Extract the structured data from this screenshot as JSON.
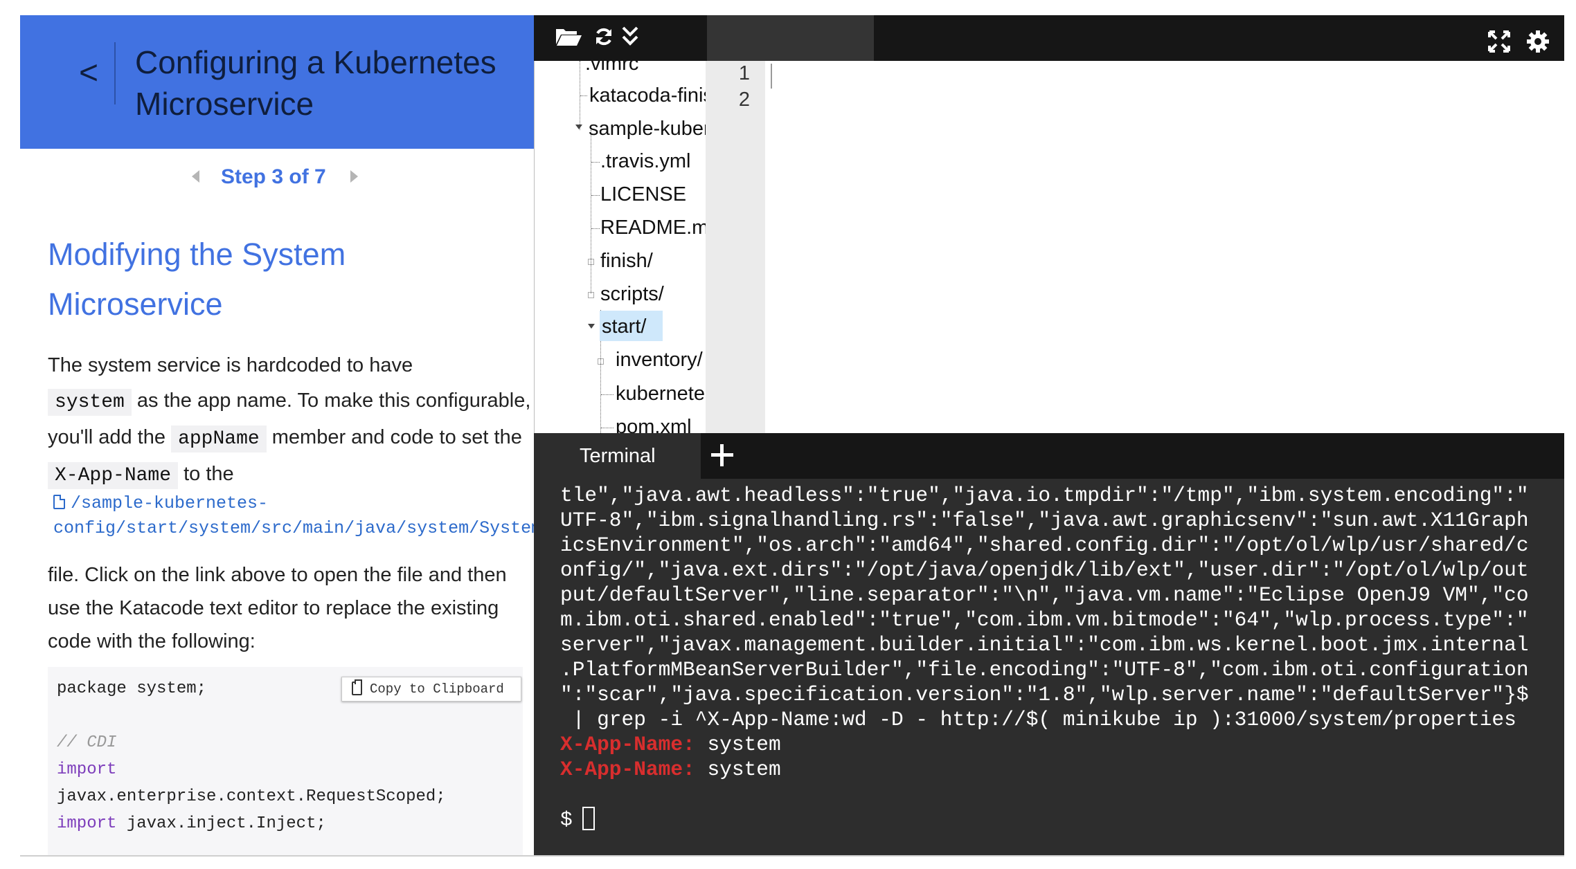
{
  "tutorial": {
    "back_label": "<",
    "title": "Configuring a Kubernetes Microservice",
    "step_label": "Step 3 of 7",
    "section_heading": "Modifying the System Microservice",
    "intro": {
      "p1": "The system service is hardcoded to have",
      "code_system": "system",
      "p2": "as the app name. To make this configurable, you'll add the",
      "code_appname": "appName",
      "p3": "member and code to set the",
      "code_header": "X-App-Name",
      "p4": "to the"
    },
    "file_link": "/sample-kubernetes-config/start/system/src/main/java/system/SystemResource.java",
    "outro": "file. Click on the link above to open the file and then use the Katacode text editor to replace the existing code with the following:",
    "copy_button_label": "Copy to Clipboard",
    "code_lines": {
      "l1": "package system;",
      "l2": "// CDI",
      "l3": "import",
      "l4": "javax.enterprise.context.RequestScoped;",
      "l5_kw": "import",
      "l5_rest": "javax.inject.Inject;"
    }
  },
  "toolbar": {
    "icons": [
      "folder-open-icon",
      "refresh-icon",
      "collapse-all-icon",
      "fullscreen-icon",
      "settings-icon"
    ]
  },
  "file_tree": {
    "items": {
      "vimrc": ".vimrc",
      "katacoda": "katacoda-finish.sh",
      "sample": "sample-kubernetes-config",
      "travis": ".travis.yml",
      "license": "LICENSE",
      "readme": "README.md",
      "finish": "finish/",
      "scripts": "scripts/",
      "start": "start/",
      "inventory": "inventory/",
      "kubernetes": "kubernetes.yaml",
      "pom": "pom.xml"
    },
    "selected": "start/"
  },
  "editor": {
    "line_numbers": [
      "1",
      "2"
    ]
  },
  "terminal": {
    "tab_label": "Terminal",
    "lines": [
      "tle\",\"java.awt.headless\":\"true\",\"java.io.tmpdir\":\"/tmp\",\"ibm.system.encoding\":\"",
      "UTF-8\",\"ibm.signalhandling.rs\":\"false\",\"java.awt.graphicsenv\":\"sun.awt.X11Graph",
      "icsEnvironment\",\"os.arch\":\"amd64\",\"shared.config.dir\":\"/opt/ol/wlp/usr/shared/c",
      "onfig/\",\"java.ext.dirs\":\"/opt/java/openjdk/lib/ext\",\"user.dir\":\"/opt/ol/wlp/out",
      "put/defaultServer\",\"line.separator\":\"\\n\",\"java.vm.name\":\"Eclipse OpenJ9 VM\",\"co",
      "m.ibm.oti.shared.enabled\":\"true\",\"com.ibm.vm.bitmode\":\"64\",\"wlp.process.type\":\"",
      "server\",\"javax.management.builder.initial\":\"com.ibm.ws.kernel.boot.jmx.internal",
      ".PlatformMBeanServerBuilder\",\"file.encoding\":\"UTF-8\",\"com.ibm.oti.configuration",
      "\":\"scar\",\"java.specification.version\":\"1.8\",\"wlp.server.name\":\"defaultServer\"}$",
      " | grep -i ^X-App-Name:wd -D - http://$( minikube ip ):31000/system/properties"
    ],
    "header_key": "X-App-Name:",
    "header_values": [
      "system",
      "system"
    ],
    "prompt": "$"
  },
  "colors": {
    "header_blue": "#4172e1",
    "link_blue": "#2c6acb",
    "terminal_bg": "#2d2d2d",
    "terminal_key_red": "#d82e2e",
    "toolbar_bg": "#161616"
  }
}
